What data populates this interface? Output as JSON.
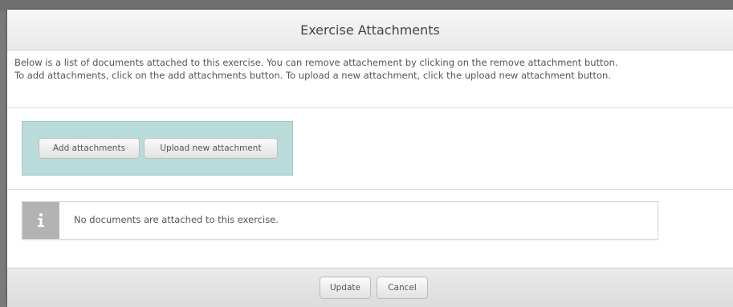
{
  "dialog": {
    "title": "Exercise Attachments",
    "description_line1": "Below is a list of documents attached to this exercise. You can remove attachement by clicking on the remove attachment button.",
    "description_line2": "To add attachments, click on the add attachments button. To upload a new attachment, click the upload new attachment button."
  },
  "actions": {
    "add_label": "Add attachments",
    "upload_label": "Upload new attachment"
  },
  "info": {
    "icon": "info-icon",
    "message": "No documents are attached to this exercise."
  },
  "footer": {
    "update_label": "Update",
    "cancel_label": "Cancel"
  },
  "colors": {
    "panel_accent": "#b9dcdb",
    "info_icon_bg": "#b3b3b3"
  }
}
